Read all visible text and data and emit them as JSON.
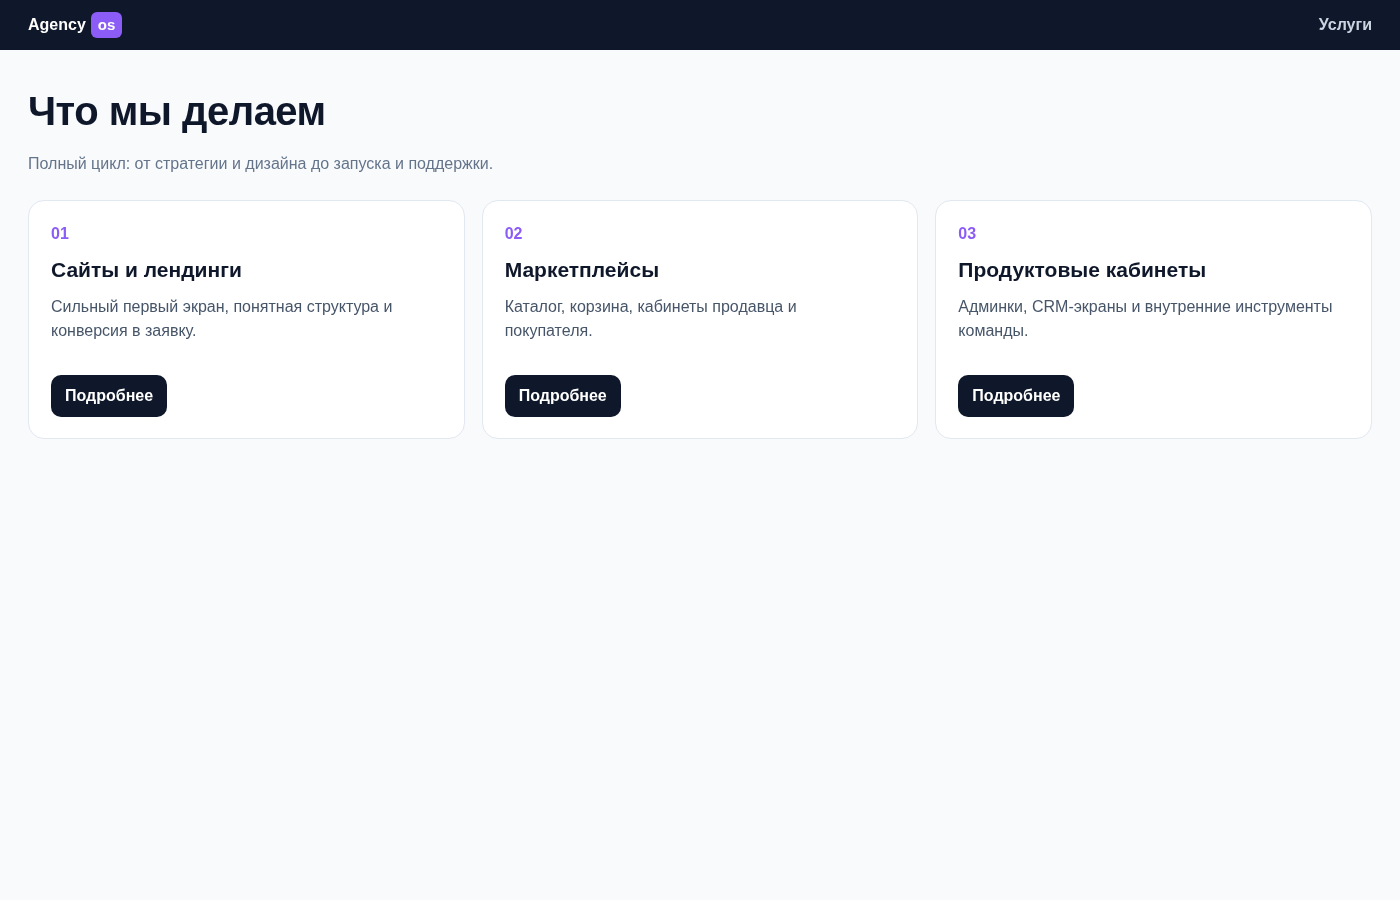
{
  "header": {
    "logo": {
      "text": "Agency",
      "badge": "os"
    },
    "nav": [
      "Услуги"
    ]
  },
  "hero": {
    "title": "Что мы делаем",
    "subtitle": "Полный цикл: от стратегии и дизайна до запуска и поддержки."
  },
  "services": [
    {
      "number": "01",
      "title": "Сайты и лендинги",
      "description": "Сильный первый экран, понятная структура и конверсия в заявку.",
      "button": "Подробнее"
    },
    {
      "number": "02",
      "title": "Маркетплейсы",
      "description": "Каталог, корзина, кабинеты продавца и покупателя.",
      "button": "Подробнее"
    },
    {
      "number": "03",
      "title": "Продуктовые кабинеты",
      "description": "Админки, CRM-экраны и внутренние инструменты команды.",
      "button": "Подробнее"
    }
  ]
}
